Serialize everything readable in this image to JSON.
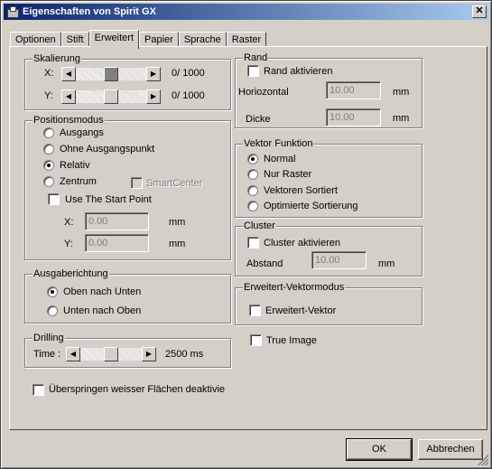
{
  "window": {
    "title": "Eigenschaften von Spirit GX"
  },
  "tabs": [
    "Optionen",
    "Stift",
    "Erweitert",
    "Papier",
    "Sprache",
    "Raster"
  ],
  "active_tab": "Erweitert",
  "skalierung": {
    "title": "Skalierung",
    "x_label": "X:",
    "x_value": "0/ 1000",
    "x_level": 0.5,
    "y_label": "Y:",
    "y_value": "0/ 1000",
    "y_level": 0.5
  },
  "positionsmodus": {
    "title": "Positionsmodus",
    "options": [
      "Ausgangs",
      "Ohne Ausgangspunkt",
      "Relativ",
      "Zentrum"
    ],
    "selected": "Relativ",
    "smartcenter": "SmartCenter",
    "use_start_point": "Use The Start Point",
    "x_label": "X:",
    "x_value": "0.00",
    "x_unit": "mm",
    "y_label": "Y:",
    "y_value": "0.00",
    "y_unit": "mm"
  },
  "ausgaberichtung": {
    "title": "Ausgaberichtung",
    "options": [
      "Oben nach Unten",
      "Unten nach Oben"
    ],
    "selected": "Oben nach Unten"
  },
  "drilling": {
    "title": "Drilling",
    "time_label": "Time :",
    "time_value": "2500 ms",
    "time_level": 0.5
  },
  "skip_white": "Überspringen weisser Flächen deaktivie",
  "rand": {
    "title": "Rand",
    "activate": "Rand aktivieren",
    "horizontal_label": "Horiozontal",
    "horizontal_value": "10.00",
    "horizontal_unit": "mm",
    "thickness_label": "Dicke",
    "thickness_value": "10.00",
    "thickness_unit": "mm"
  },
  "vektor": {
    "title": "Vektor Funktion",
    "options": [
      "Normal",
      "Nur Raster",
      "Vektoren Sortiert",
      "Optimierte Sortierung"
    ],
    "selected": "Normal"
  },
  "cluster": {
    "title": "Cluster",
    "activate": "Cluster aktivieren",
    "distance_label": "Abstand",
    "distance_value": "10.00",
    "distance_unit": "mm"
  },
  "erweitert_vektor": {
    "title": "Erweitert-Vektormodus",
    "checkbox": "Erweitert-Vektor"
  },
  "true_image": "True Image",
  "buttons": {
    "ok": "OK",
    "cancel": "Abbrechen"
  },
  "icons": [
    "printer-icon",
    "close-icon",
    "arrow-left-icon",
    "arrow-right-icon"
  ]
}
